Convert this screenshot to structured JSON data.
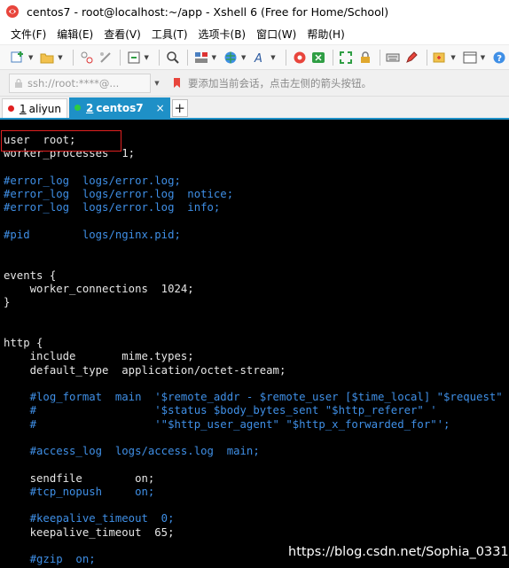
{
  "window": {
    "title": "centos7 - root@localhost:~/app - Xshell 6 (Free for Home/School)"
  },
  "menu": {
    "items": [
      {
        "label": "文件(F)"
      },
      {
        "label": "编辑(E)"
      },
      {
        "label": "查看(V)"
      },
      {
        "label": "工具(T)"
      },
      {
        "label": "选项卡(B)"
      },
      {
        "label": "窗口(W)"
      },
      {
        "label": "帮助(H)"
      }
    ]
  },
  "address": {
    "value": "ssh://root:****@...",
    "hint": "要添加当前会话，点击左侧的箭头按钮。"
  },
  "tabs": [
    {
      "num": "1",
      "label": "aliyun",
      "dot_color": "#e02020",
      "active": false
    },
    {
      "num": "2",
      "label": "centos7",
      "dot_color": "#2ecc40",
      "active": true,
      "close": "×"
    }
  ],
  "tab_add": "+",
  "terminal": {
    "lines": [
      {
        "text": "user  root;",
        "kind": "normal"
      },
      {
        "text": "worker_processes  1;",
        "kind": "normal"
      },
      {
        "text": "",
        "kind": "normal"
      },
      {
        "text": "#error_log  logs/error.log;",
        "kind": "comment"
      },
      {
        "text": "#error_log  logs/error.log  notice;",
        "kind": "comment"
      },
      {
        "text": "#error_log  logs/error.log  info;",
        "kind": "comment"
      },
      {
        "text": "",
        "kind": "normal"
      },
      {
        "text": "#pid        logs/nginx.pid;",
        "kind": "comment"
      },
      {
        "text": "",
        "kind": "normal"
      },
      {
        "text": "",
        "kind": "normal"
      },
      {
        "text": "events {",
        "kind": "normal"
      },
      {
        "text": "    worker_connections  1024;",
        "kind": "normal"
      },
      {
        "text": "}",
        "kind": "normal"
      },
      {
        "text": "",
        "kind": "normal"
      },
      {
        "text": "",
        "kind": "normal"
      },
      {
        "text": "http {",
        "kind": "normal"
      },
      {
        "text": "    include       mime.types;",
        "kind": "normal"
      },
      {
        "text": "    default_type  application/octet-stream;",
        "kind": "normal"
      },
      {
        "text": "",
        "kind": "normal"
      },
      {
        "text": "    #log_format  main  '$remote_addr - $remote_user [$time_local] \"$request\" '",
        "kind": "comment"
      },
      {
        "text": "    #                  '$status $body_bytes_sent \"$http_referer\" '",
        "kind": "comment"
      },
      {
        "text": "    #                  '\"$http_user_agent\" \"$http_x_forwarded_for\"';",
        "kind": "comment"
      },
      {
        "text": "",
        "kind": "normal"
      },
      {
        "text": "    #access_log  logs/access.log  main;",
        "kind": "comment"
      },
      {
        "text": "",
        "kind": "normal"
      },
      {
        "text": "    sendfile        on;",
        "kind": "normal"
      },
      {
        "text": "    #tcp_nopush     on;",
        "kind": "comment"
      },
      {
        "text": "",
        "kind": "normal"
      },
      {
        "text": "    #keepalive_timeout  0;",
        "kind": "comment"
      },
      {
        "text": "    keepalive_timeout  65;",
        "kind": "normal"
      },
      {
        "text": "",
        "kind": "normal"
      },
      {
        "text": "    #gzip  on;",
        "kind": "comment"
      }
    ],
    "watermark": "https://blog.csdn.net/Sophia_0331"
  },
  "colors": {
    "tab_active": "#1e90c7",
    "terminal_bg": "#000000",
    "comment": "#3f8fe6",
    "highlight": "#e02020"
  }
}
